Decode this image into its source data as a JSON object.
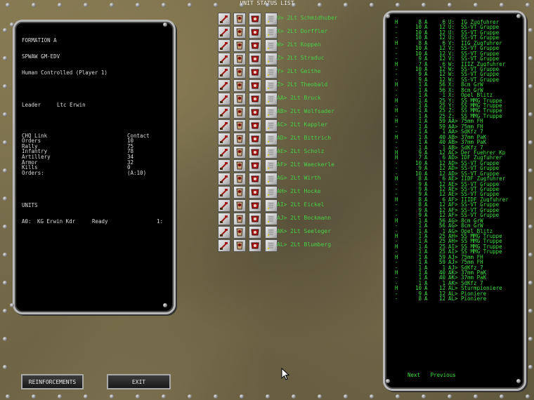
{
  "window": {
    "title": "UNIT STATUS LIST"
  },
  "formation": {
    "name": "FORMATION A",
    "code": "SPWAW GM-EDV",
    "control": "Human Controlled (Player 1)",
    "leader_label": "Leader",
    "leader_value": "Ltc Erwin",
    "stats": [
      {
        "k": "CHQ Link",
        "v": "Contact"
      },
      {
        "k": "Orders",
        "v": "10"
      },
      {
        "k": "Rally",
        "v": "75"
      },
      {
        "k": "Infantry",
        "v": "78"
      },
      {
        "k": "Artillery",
        "v": "34"
      },
      {
        "k": "Armor",
        "v": "32"
      },
      {
        "k": "Kills",
        "v": "0"
      },
      {
        "k": "Orders:",
        "v": "(A:10)"
      }
    ],
    "units_label": "UNITS",
    "units": [
      {
        "id": "A0:",
        "name": "KG Erwin Kdr",
        "status": "Ready",
        "value": "1:"
      }
    ]
  },
  "groups": [
    {
      "label": "U> 2Lt Schmidhuber"
    },
    {
      "label": "X> 2Lt Dorffler"
    },
    {
      "label": "W> 2Lt Koppen"
    },
    {
      "label": "Z> 2Lt Straduc"
    },
    {
      "label": "Y> 2Lt Geithe"
    },
    {
      "label": "Z> 2Lt Theobald"
    },
    {
      "label": "AA> 2Lt Bruck"
    },
    {
      "label": "AB> 2Lt Wolfsader"
    },
    {
      "label": "AC> 2Lt Kappler"
    },
    {
      "label": "AD> 2Lt Bittrich"
    },
    {
      "label": "AE> 2Lt Scholz"
    },
    {
      "label": "AF> 2Lt Waeckerle"
    },
    {
      "label": "AG> 2Lt Wirth"
    },
    {
      "label": "AH> 2Lt Hocke"
    },
    {
      "label": "AI> 2Lt Eickel"
    },
    {
      "label": "AJ> 2Lt Bockmann"
    },
    {
      "label": "AK> 2Lt Seeleger"
    },
    {
      "label": "AL> 2Lt Blumberg"
    }
  ],
  "status_list": [
    [
      "H",
      "8",
      "A",
      "6",
      "U:",
      "IG Zugfuhrer"
    ],
    [
      "-",
      "10",
      "A",
      "12",
      "U:",
      "SS-VT Gruppe"
    ],
    [
      "-",
      "10",
      "A",
      "12",
      "U:",
      "SS-VT Gruppe"
    ],
    [
      "-",
      "10",
      "A",
      "12",
      "U:",
      "SS-VT Gruppe"
    ],
    [
      "H",
      "8",
      "A",
      "6",
      "V:",
      "IIG Zugfuhrer"
    ],
    [
      "-",
      "10",
      "A",
      "12",
      "V:",
      "SS-VT Gruppe"
    ],
    [
      "-",
      "10",
      "A",
      "12",
      "V:",
      "SS-VT Gruppe"
    ],
    [
      "-",
      "9",
      "A",
      "12",
      "V:",
      "SS-VT Gruppe"
    ],
    [
      "H",
      "7",
      "A",
      "6",
      "W:",
      "IIIZ Zugfuhrer"
    ],
    [
      "-",
      "10",
      "A",
      "12",
      "W:",
      "SS-VT Gruppe"
    ],
    [
      "-",
      "9",
      "A",
      "12",
      "W:",
      "SS-VT Gruppe"
    ],
    [
      "-",
      "9",
      "A",
      "12",
      "W:",
      "SS-VT Gruppe"
    ],
    [
      "H",
      "1",
      "A",
      "56",
      "X:",
      "8cm GrW"
    ],
    [
      "-",
      "1",
      "A",
      "56",
      "X:",
      "8cm GrW"
    ],
    [
      "-",
      "1",
      "A",
      "1",
      "X:",
      "Opel Blitz"
    ],
    [
      "H",
      "1",
      "A",
      "25",
      "Y:",
      "SS MMG Truppe"
    ],
    [
      "-",
      "1",
      "A",
      "25",
      "Y:",
      "SS MMG Truppe"
    ],
    [
      "H",
      "1",
      "A",
      "25",
      "Z:",
      "SS MMG Truppe"
    ],
    [
      "-",
      "1",
      "A",
      "25",
      "Z:",
      "SS MMG Truppe"
    ],
    [
      "H",
      "1",
      "A",
      "59",
      "AA>",
      "75mm FH"
    ],
    [
      "-",
      "1",
      "A",
      "59",
      "AA>",
      "75mm FH"
    ],
    [
      "-",
      "1",
      "A",
      "1",
      "AA>",
      "SdKfz 7"
    ],
    [
      "H",
      "1",
      "A",
      "40",
      "AB>",
      "37mm PaK"
    ],
    [
      "-",
      "1",
      "A",
      "40",
      "AB>",
      "37mm PaK"
    ],
    [
      "-",
      "1",
      "A",
      "1",
      "AB>",
      "SdKfz 7"
    ],
    [
      "H",
      "9",
      "A",
      "12",
      "AC>",
      "Der Fuehrer Kp"
    ],
    [
      "H",
      "7",
      "A",
      "6",
      "AD>",
      "IDF Zugfuhrer"
    ],
    [
      "-",
      "10",
      "A",
      "12",
      "AD>",
      "SS-VT Gruppe"
    ],
    [
      "-",
      "9",
      "A",
      "12",
      "AD>",
      "SS-VT Gruppe"
    ],
    [
      "-",
      "10",
      "A",
      "12",
      "AD>",
      "SS-VT Gruppe"
    ],
    [
      "H",
      "8",
      "A",
      "6",
      "AE>",
      "IIDF Zugfuhrer"
    ],
    [
      "-",
      "9",
      "A",
      "12",
      "AE>",
      "SS-VT Gruppe"
    ],
    [
      "-",
      "9",
      "A",
      "12",
      "AE>",
      "SS-VT Gruppe"
    ],
    [
      "-",
      "9",
      "A",
      "12",
      "AE>",
      "SS-VT Gruppe"
    ],
    [
      "H",
      "8",
      "A",
      "6",
      "AF>",
      "IIIDF Zugfuhrer"
    ],
    [
      "-",
      "8",
      "A",
      "12",
      "AF>",
      "SS-VT Gruppe"
    ],
    [
      "-",
      "9",
      "A",
      "12",
      "AF>",
      "SS-VT Gruppe"
    ],
    [
      "-",
      "9",
      "A",
      "12",
      "AF>",
      "SS-VT Gruppe"
    ],
    [
      "H",
      "1",
      "A",
      "56",
      "AG>",
      "8cm GrW"
    ],
    [
      "-",
      "1",
      "A",
      "56",
      "AG>",
      "8cm GrW"
    ],
    [
      "-",
      "1",
      "A",
      "1",
      "AG>",
      "Opel Blitz"
    ],
    [
      "H",
      "1",
      "A",
      "25",
      "AH>",
      "SS MMG Truppe"
    ],
    [
      "-",
      "1",
      "A",
      "25",
      "AH>",
      "SS MMG Truppe"
    ],
    [
      "H",
      "1",
      "A",
      "25",
      "AI>",
      "SS MMG Truppe"
    ],
    [
      "-",
      "1",
      "A",
      "25",
      "AI>",
      "SS MMG Truppe"
    ],
    [
      "H",
      "1",
      "A",
      "59",
      "AJ>",
      "75mm FH"
    ],
    [
      "-",
      "1",
      "A",
      "59",
      "AJ>",
      "75mm FH"
    ],
    [
      "-",
      "1",
      "A",
      "1",
      "AJ>",
      "SdKfz 7"
    ],
    [
      "H",
      "1",
      "A",
      "40",
      "AK>",
      "37mm PaK"
    ],
    [
      "-",
      "1",
      "A",
      "40",
      "AK>",
      "37mm PaK"
    ],
    [
      "-",
      "1",
      "A",
      "1",
      "AK>",
      "SdKfz 7"
    ],
    [
      "H",
      "10",
      "A",
      "12",
      "AL>",
      "Sturmpioniere"
    ],
    [
      "-",
      "9",
      "A",
      "12",
      "AL>",
      "Pioniere"
    ],
    [
      "-",
      "8",
      "A",
      "12",
      "AL>",
      "Pioniere"
    ]
  ],
  "nav": {
    "next": "Next",
    "previous": "Previous"
  },
  "buttons": {
    "reinforcements": "REINFORCEMENTS",
    "exit": "EXIT"
  },
  "colors": {
    "list_text": "#3ee03e",
    "label_text": "#48d048",
    "panel_bg": "#000000"
  }
}
